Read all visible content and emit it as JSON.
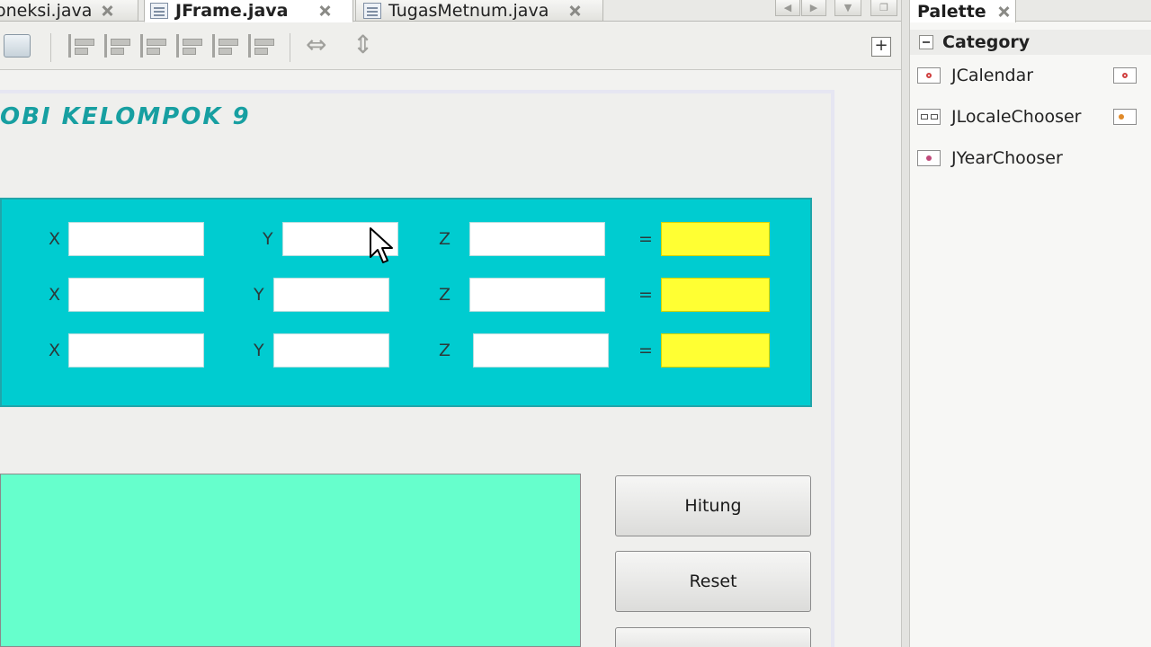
{
  "editor_tabs": [
    {
      "label": "oneksi.java",
      "active": false
    },
    {
      "label": "JFrame.java",
      "active": true
    },
    {
      "label": "TugasMetnum.java",
      "active": false
    }
  ],
  "form": {
    "title": "OBI KELOMPOK 9",
    "labels": {
      "x": "X",
      "y": "Y",
      "z": "Z",
      "equals": "="
    },
    "buttons": {
      "hitung": "Hitung",
      "reset": "Reset"
    },
    "colors": {
      "panel": "#00ccd0",
      "result_field": "#ffff33",
      "output_area": "#66ffcc",
      "title": "#179fa1"
    }
  },
  "palette": {
    "title": "Palette",
    "category": "Category",
    "items": [
      "JCalendar",
      "JLocaleChooser",
      "JYearChooser"
    ]
  }
}
